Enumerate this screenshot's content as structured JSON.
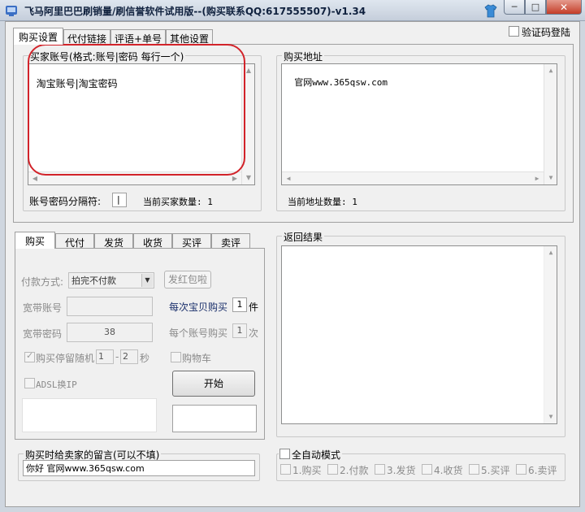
{
  "window": {
    "title": "飞马阿里巴巴刷销量/刷信誉软件试用版--(购买联系QQ:617555507)-v1.34",
    "buttons": {
      "minimize": "─",
      "maximize": "□",
      "close": "✕"
    }
  },
  "top_tabs": [
    "购买设置",
    "代付链接",
    "评语+单号",
    "其他设置"
  ],
  "captcha_login": {
    "label": "验证码登陆"
  },
  "buyer_accounts": {
    "label": "买家账号(格式:账号|密码 每行一个)",
    "content": "淘宝账号|淘宝密码",
    "separator_label": "账号密码分隔符:",
    "separator_value": "|",
    "count_label": "当前买家数量: 1"
  },
  "purchase_urls": {
    "label": "购买地址",
    "content": "官网www.365qsw.com",
    "count_label": "当前地址数量: 1"
  },
  "bottom_tabs": [
    "购买",
    "代付",
    "发货",
    "收货",
    "买评",
    "卖评"
  ],
  "buy_form": {
    "payment_label": "付款方式:",
    "payment_value": "拍完不付款",
    "red_packet_button": "发红包啦",
    "broadband_account_label": "宽带账号",
    "broadband_password_label": "宽带密码",
    "broadband_password_value": "38",
    "per_item_label": "每次宝贝购买",
    "per_item_value": "1",
    "per_item_unit": "件",
    "per_account_label": "每个账号购买",
    "per_account_value": "1",
    "per_account_unit": "次",
    "random_pause_label": "购买停留随机",
    "random_min": "1",
    "random_dash": "-",
    "random_max": "2",
    "random_unit": "秒",
    "cart_label": "购物车",
    "adsl_label": "ADSL换IP",
    "start_button": "开始"
  },
  "result": {
    "label": "返回结果"
  },
  "seller_message": {
    "label": "购买时给卖家的留言(可以不填)",
    "value": "你好  官网www.365qsw.com"
  },
  "auto_mode": {
    "label": "全自动模式",
    "steps": [
      "1.购买",
      "2.付款",
      "3.发货",
      "4.收货",
      "5.买评",
      "6.卖评"
    ]
  }
}
